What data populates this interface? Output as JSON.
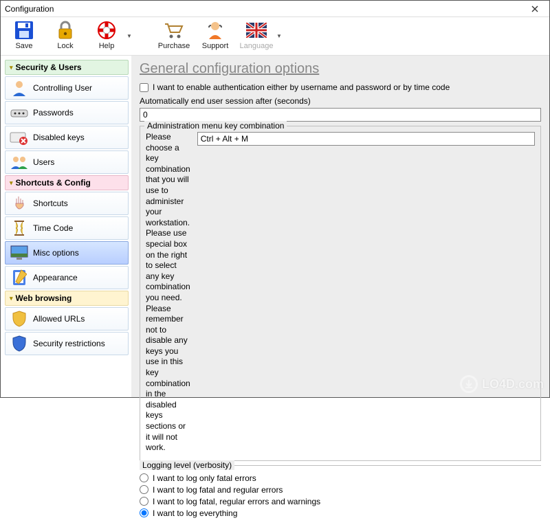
{
  "window": {
    "title": "Configuration"
  },
  "toolbar": {
    "save": "Save",
    "lock": "Lock",
    "help": "Help",
    "purchase": "Purchase",
    "support": "Support",
    "language": "Language"
  },
  "sidebar": {
    "group1": {
      "title": "Security & Users",
      "items": [
        "Controlling User",
        "Passwords",
        "Disabled keys",
        "Users"
      ]
    },
    "group2": {
      "title": "Shortcuts & Config",
      "items": [
        "Shortcuts",
        "Time Code",
        "Misc options",
        "Appearance"
      ]
    },
    "group3": {
      "title": "Web browsing",
      "items": [
        "Allowed URLs",
        "Security restrictions"
      ]
    }
  },
  "content": {
    "heading": "General configuration options",
    "auth_checkbox": "I want to enable authentication either by username and password or by time code",
    "auto_end_label": "Automatically end user session after (seconds)",
    "auto_end_value": "0",
    "admin_legend": "Administration menu key combination",
    "admin_text": "Please choose a key combination that you will use to administer your workstation. Please use special box on the right to select any key combination you need. Please remember not to disable any keys you use in this key combination in the disabled keys sections or it will not work.",
    "admin_key": "Ctrl + Alt + M",
    "log_legend": "Logging level (verbosity)",
    "log_options": [
      "I want to log only fatal errors",
      "I want to log fatal and regular errors",
      "I want to log fatal, regular errors and warnings",
      "I want to log everything"
    ],
    "log_selected": 3
  },
  "watermark": "LO4D.com"
}
